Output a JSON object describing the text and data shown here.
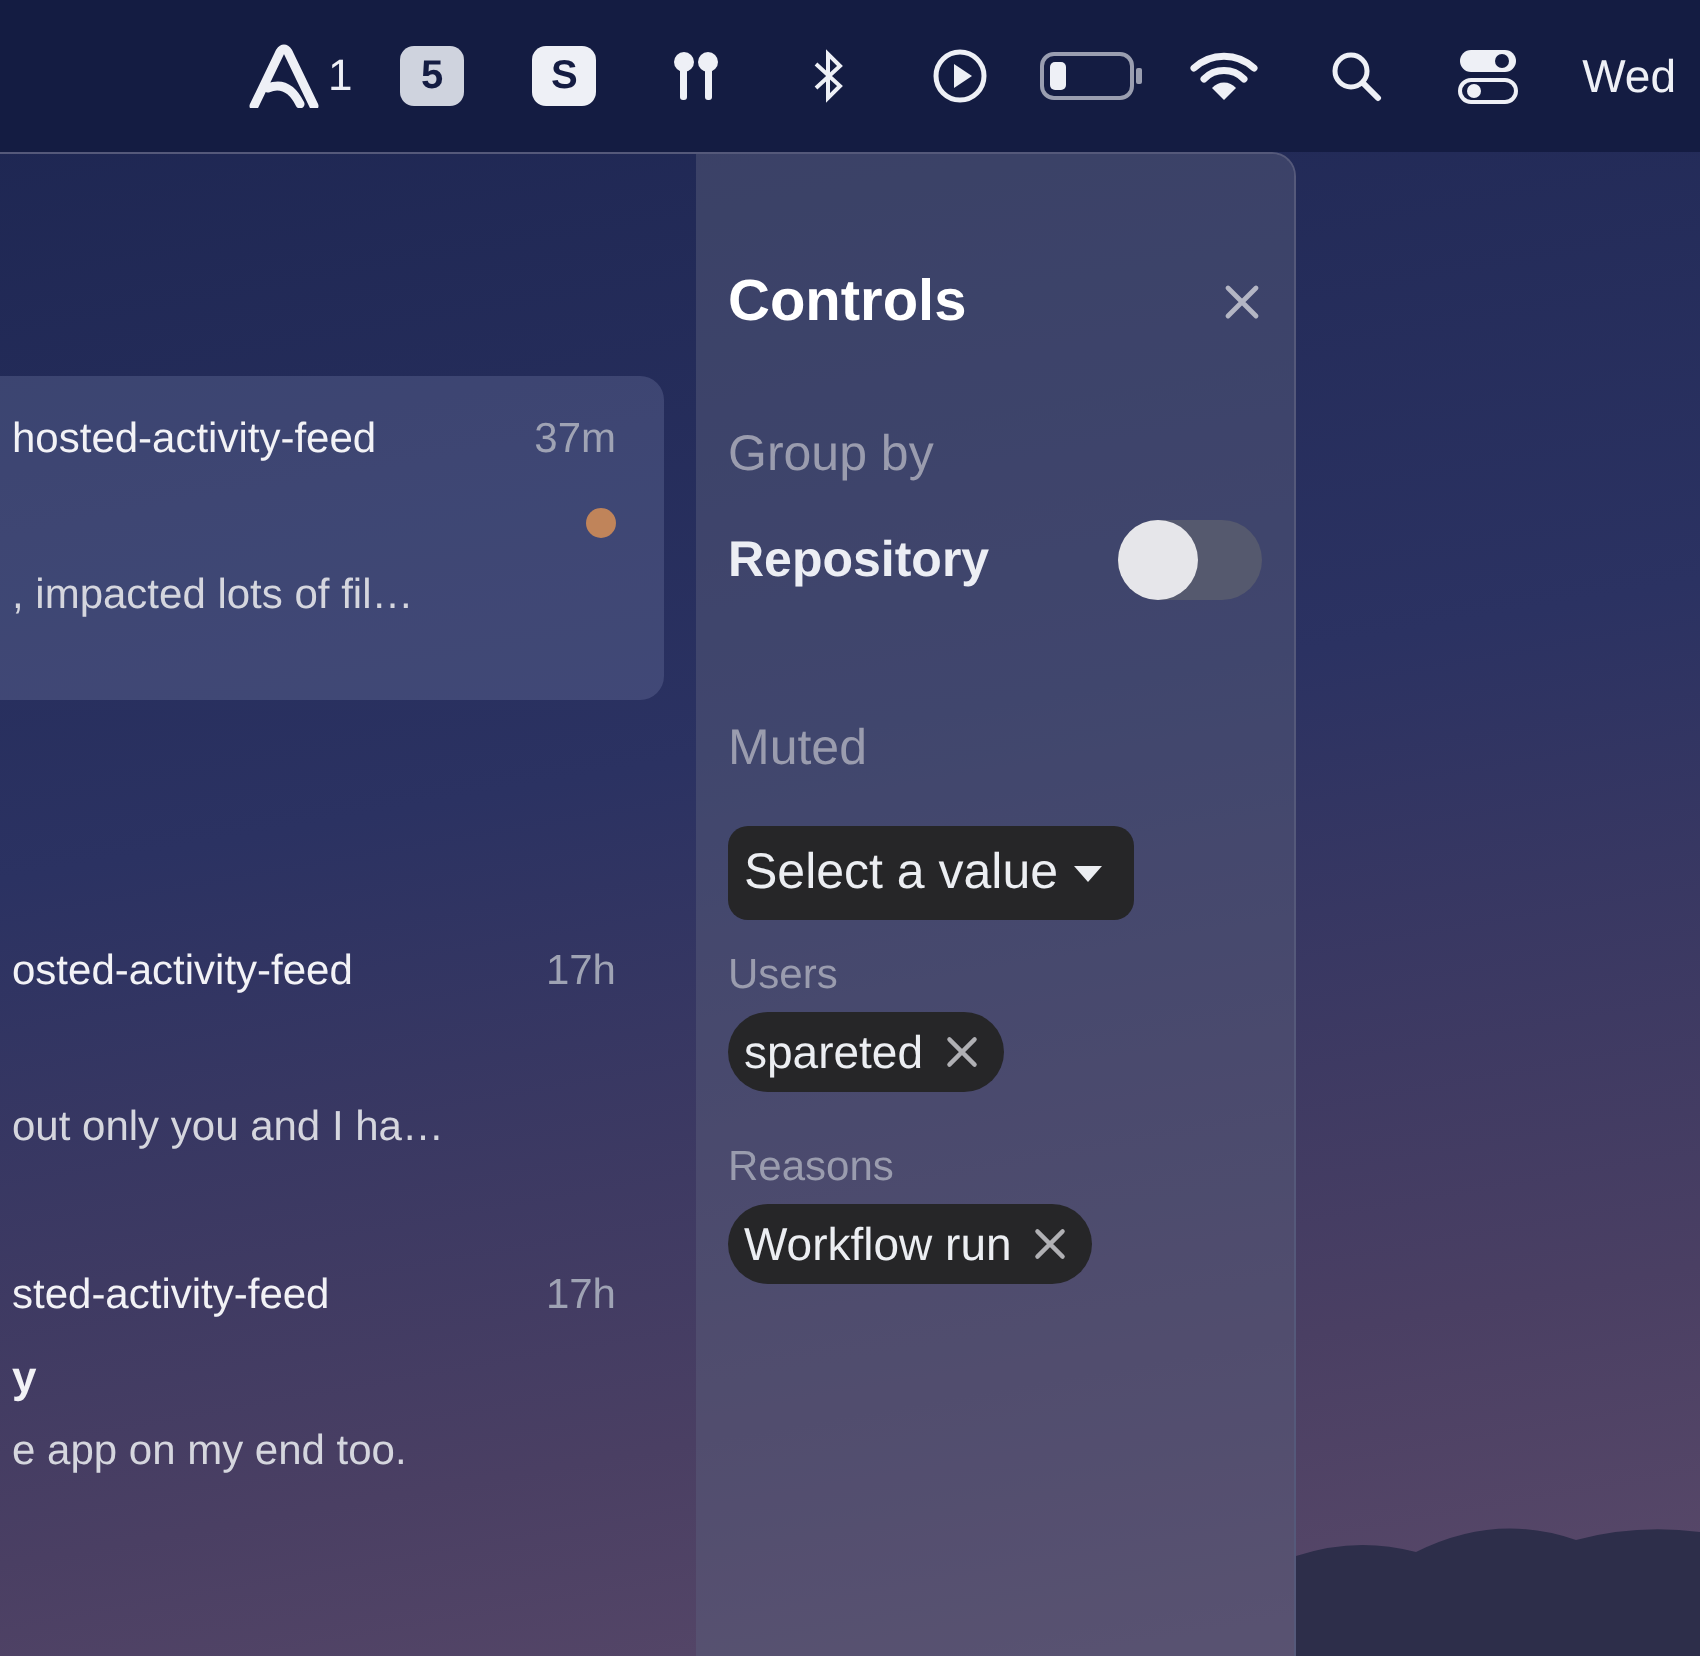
{
  "menu_bar": {
    "app_badge": "1",
    "items": [
      {
        "kind": "numbered",
        "label": "5"
      },
      {
        "kind": "letter",
        "label": "S"
      },
      {
        "kind": "earbuds"
      },
      {
        "kind": "bluetooth"
      },
      {
        "kind": "play"
      },
      {
        "kind": "battery"
      },
      {
        "kind": "wifi"
      },
      {
        "kind": "search"
      },
      {
        "kind": "switches"
      }
    ],
    "clock": "Wed"
  },
  "feed": [
    {
      "title": "hosted-activity-feed",
      "time": "37m",
      "body": ", impacted lots of fil…",
      "selected": true,
      "unread": true
    },
    {
      "title": "osted-activity-feed",
      "time": "17h",
      "body": "out only you and I ha…",
      "selected": false,
      "unread": false
    },
    {
      "title": "sted-activity-feed",
      "time": "17h",
      "subtitle": "y",
      "body": "e app on my end too.",
      "selected": false,
      "unread": false
    }
  ],
  "controls": {
    "title": "Controls",
    "group_by": {
      "label": "Group by",
      "option": "Repository",
      "on": false
    },
    "muted": {
      "label": "Muted",
      "select": {
        "placeholder": "Select a value"
      },
      "groups": [
        {
          "label": "Users",
          "chips": [
            "spareted"
          ]
        },
        {
          "label": "Reasons",
          "chips": [
            "Workflow run"
          ]
        }
      ]
    }
  }
}
